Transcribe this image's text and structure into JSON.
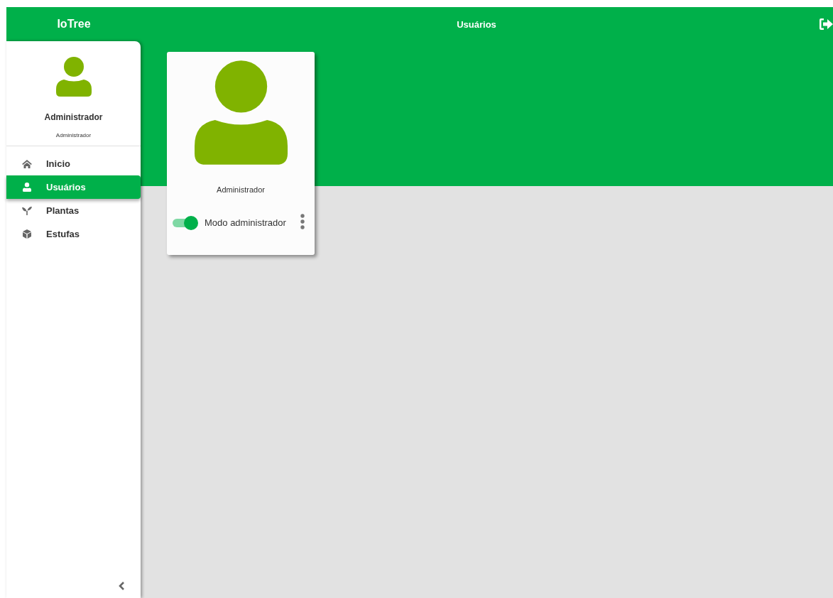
{
  "header": {
    "logo": "IoTree",
    "title": "Usuários"
  },
  "profile": {
    "name": "Administrador",
    "role": "Administrador"
  },
  "nav": [
    {
      "label": "Inicio",
      "kind": "home",
      "selected": false
    },
    {
      "label": "Usuários",
      "kind": "user",
      "selected": true
    },
    {
      "label": "Plantas",
      "kind": "sprout",
      "selected": false
    },
    {
      "label": "Estufas",
      "kind": "box",
      "selected": false
    }
  ],
  "users": [
    {
      "name": "Administrador",
      "toggle_label": "Modo administrador",
      "on": true
    }
  ]
}
